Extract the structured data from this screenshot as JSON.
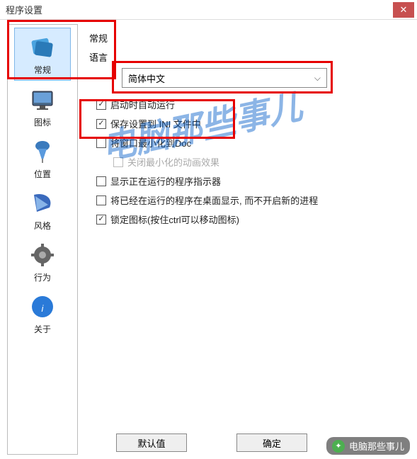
{
  "window": {
    "title": "程序设置"
  },
  "sidebar": {
    "items": [
      {
        "label": "常规",
        "icon": "settings"
      },
      {
        "label": "图标",
        "icon": "monitor"
      },
      {
        "label": "位置",
        "icon": "pin"
      },
      {
        "label": "风格",
        "icon": "palette"
      },
      {
        "label": "行为",
        "icon": "gear"
      },
      {
        "label": "关于",
        "icon": "info"
      }
    ]
  },
  "main": {
    "section": "常规",
    "language_label": "语言",
    "language_value": "简体中文",
    "options": [
      {
        "label": "启动时自动运行",
        "checked": true,
        "disabled": false
      },
      {
        "label": "保存设置到 INI 文件中",
        "checked": true,
        "disabled": false
      },
      {
        "label": "将窗口最小化到Doc",
        "checked": false,
        "disabled": false
      },
      {
        "label": "关闭最小化的动画效果",
        "checked": false,
        "disabled": true
      },
      {
        "label": "显示正在运行的程序指示器",
        "checked": false,
        "disabled": false
      },
      {
        "label": "将已经在运行的程序在桌面显示, 而不开启新的进程",
        "checked": false,
        "disabled": false
      },
      {
        "label": "锁定图标(按住ctrl可以移动图标)",
        "checked": true,
        "disabled": false
      }
    ]
  },
  "buttons": {
    "default": "默认值",
    "ok": "确定"
  },
  "watermark": "电脑那些事儿",
  "credit": "电脑那些事儿"
}
